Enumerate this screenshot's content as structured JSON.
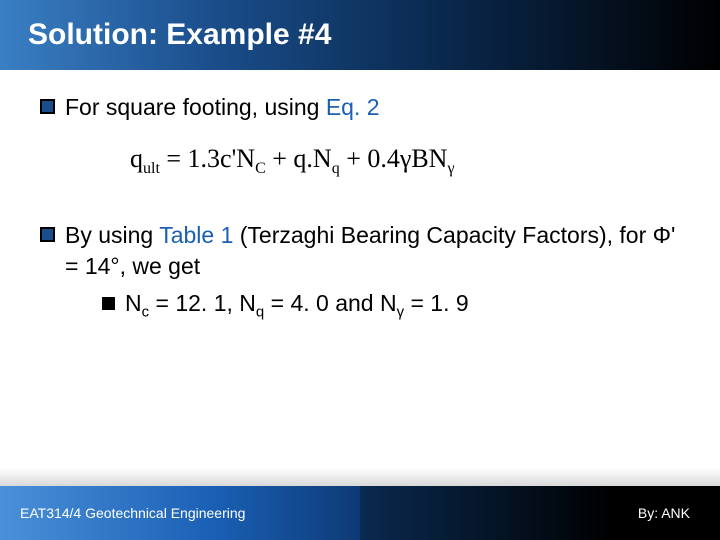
{
  "title": "Solution: Example #4",
  "bullets": {
    "first": {
      "prefix": "For square footing, using ",
      "link": "Eq. 2"
    },
    "equation": {
      "text_html": "q<sub>ult</sub> = 1.3c'N<sub>C</sub> + q.N<sub>q</sub> + 0.4γBN<sub>γ</sub>"
    },
    "second": {
      "prefix": "By using ",
      "link": "Table 1 ",
      "after_link": "(Terzaghi Bearing Capacity Factors), for Φ' = 14°, we get",
      "sub": "Nc = 12. 1, Nq = 4. 0 and Nγ = 1.9",
      "sub_html": "N<sub>c</sub> = 12. 1, N<sub>q</sub> = 4. 0 and N<sub>γ</sub> = 1. 9"
    }
  },
  "footer": {
    "left": "EAT314/4 Geotechnical Engineering",
    "right": "By: ANK"
  }
}
